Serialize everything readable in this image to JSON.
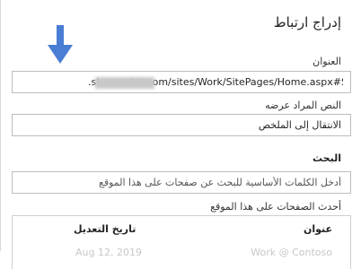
{
  "dialog": {
    "title": "إدراج ارتباط"
  },
  "address": {
    "label": "العنوان",
    "value_suffix": ".sharepoint.com/sites/Work/SitePages/Home.aspx#Summary"
  },
  "display_text": {
    "label": "النص المراد عرضه",
    "value": "الانتقال إلى الملخص"
  },
  "search": {
    "label": "البحث",
    "placeholder": "أدخل الكلمات الأساسية للبحث عن صفحات على هذا الموقع"
  },
  "recent_pages": {
    "label": "أحدث الصفحات على هذا الموقع",
    "columns": {
      "title": "عنوان",
      "modified": "تاريخ التعديل"
    },
    "rows": [
      {
        "title": "Work @ Contoso",
        "modified": "Aug 12, 2019"
      }
    ]
  },
  "colors": {
    "arrow": "#4a7dd4",
    "border": "#bdbdbd"
  },
  "icons": {
    "annotation": "arrow-down-icon"
  }
}
